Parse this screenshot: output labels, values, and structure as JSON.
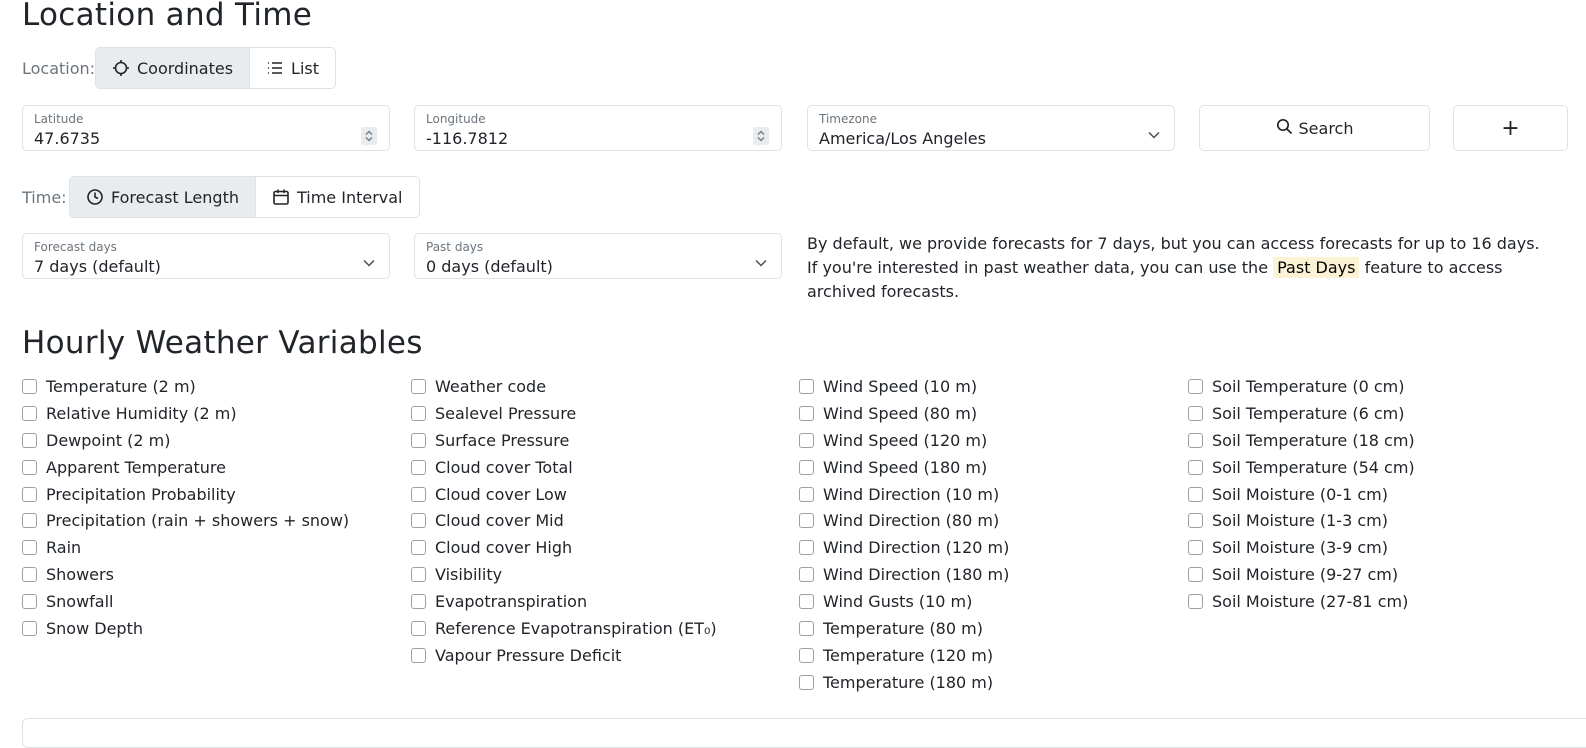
{
  "location_time": {
    "heading": "Location and Time",
    "location_label": "Location:",
    "location_modes": [
      {
        "label": "Coordinates",
        "icon": "crosshair-icon",
        "active": true
      },
      {
        "label": "List",
        "icon": "list-icon",
        "active": false
      }
    ],
    "latitude": {
      "label": "Latitude",
      "value": "47.6735"
    },
    "longitude": {
      "label": "Longitude",
      "value": "-116.7812"
    },
    "timezone": {
      "label": "Timezone",
      "value": "America/Los Angeles"
    },
    "search_button": "Search",
    "add_button": "+",
    "time_label": "Time:",
    "time_modes": [
      {
        "label": "Forecast Length",
        "icon": "clock-icon",
        "active": true
      },
      {
        "label": "Time Interval",
        "icon": "calendar-icon",
        "active": false
      }
    ],
    "forecast_days": {
      "label": "Forecast days",
      "value": "7 days (default)"
    },
    "past_days": {
      "label": "Past days",
      "value": "0 days (default)"
    },
    "info": {
      "before": "By default, we provide forecasts for 7 days, but you can access forecasts for up to 16 days. If you're interested in past weather data, you can use the ",
      "highlight": "Past Days",
      "after": " feature to access archived forecasts."
    }
  },
  "hourly": {
    "heading": "Hourly Weather Variables",
    "columns": [
      [
        "Temperature (2 m)",
        "Relative Humidity (2 m)",
        "Dewpoint (2 m)",
        "Apparent Temperature",
        "Precipitation Probability",
        "Precipitation (rain + showers + snow)",
        "Rain",
        "Showers",
        "Snowfall",
        "Snow Depth"
      ],
      [
        "Weather code",
        "Sealevel Pressure",
        "Surface Pressure",
        "Cloud cover Total",
        "Cloud cover Low",
        "Cloud cover Mid",
        "Cloud cover High",
        "Visibility",
        "Evapotranspiration",
        "Reference Evapotranspiration (ET₀)",
        "Vapour Pressure Deficit"
      ],
      [
        "Wind Speed (10 m)",
        "Wind Speed (80 m)",
        "Wind Speed (120 m)",
        "Wind Speed (180 m)",
        "Wind Direction (10 m)",
        "Wind Direction (80 m)",
        "Wind Direction (120 m)",
        "Wind Direction (180 m)",
        "Wind Gusts (10 m)",
        "Temperature (80 m)",
        "Temperature (120 m)",
        "Temperature (180 m)"
      ],
      [
        "Soil Temperature (0 cm)",
        "Soil Temperature (6 cm)",
        "Soil Temperature (18 cm)",
        "Soil Temperature (54 cm)",
        "Soil Moisture (0-1 cm)",
        "Soil Moisture (1-3 cm)",
        "Soil Moisture (3-9 cm)",
        "Soil Moisture (9-27 cm)",
        "Soil Moisture (27-81 cm)"
      ]
    ]
  }
}
